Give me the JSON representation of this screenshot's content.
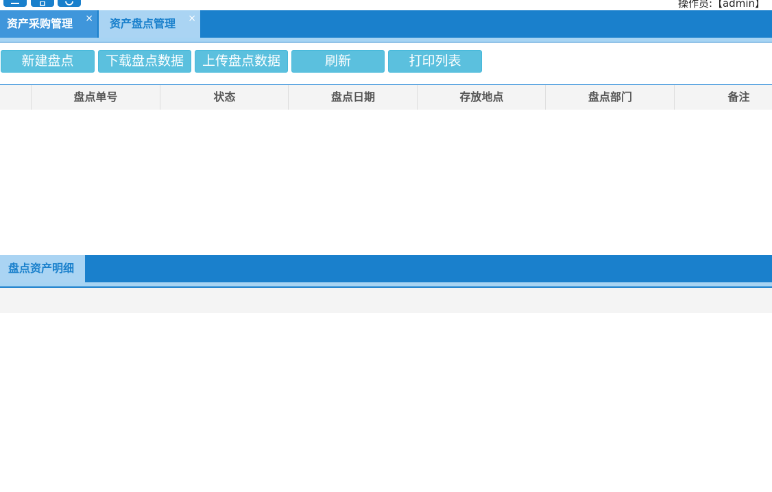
{
  "header": {
    "operator_text": "操作员:【admin】",
    "icons": [
      "list-icon",
      "document-icon",
      "refresh-icon"
    ]
  },
  "tabs": [
    {
      "label": "资产采购管理",
      "close": "×",
      "active": false
    },
    {
      "label": "资产盘点管理",
      "close": "×",
      "active": true
    }
  ],
  "toolbar": {
    "new_label": "新建盘点",
    "download_label": "下载盘点数据",
    "upload_label": "上传盘点数据",
    "refresh_label": "刷新",
    "print_label": "打印列表"
  },
  "grid": {
    "columns": [
      "",
      "盘点单号",
      "状态",
      "盘点日期",
      "存放地点",
      "盘点部门",
      "备注"
    ],
    "rows": []
  },
  "detail_panel": {
    "tab_label": "盘点资产明细"
  },
  "colors": {
    "primary": "#1a80cc",
    "tab_light": "#aad4f3",
    "button": "#5bc0de",
    "header_bg": "#f4f4f4"
  }
}
